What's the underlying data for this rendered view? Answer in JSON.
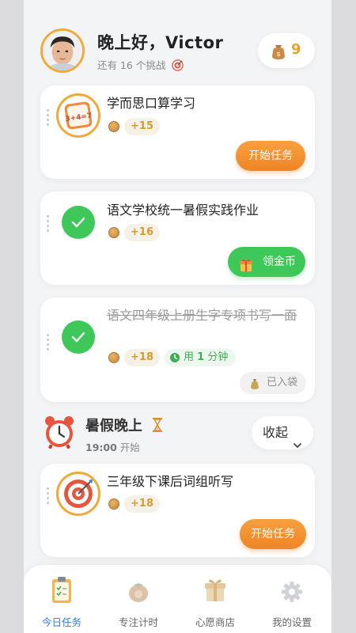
{
  "header": {
    "greeting": "晚上好，Victor",
    "subtitle": "还有 16 个挑战",
    "coins": "9"
  },
  "tasks": [
    {
      "title": "学而思口算学习",
      "points": "+15",
      "action_label": "开始任务",
      "status": "todo"
    },
    {
      "title": "语文学校统一暑假实践作业",
      "points": "+16",
      "action_label": "领金币",
      "status": "completed"
    },
    {
      "title": "语文四年级上册生字专项书写一面",
      "points": "+18",
      "duration_prefix": "用",
      "duration_value": "1",
      "duration_unit": "分钟",
      "action_label": "已入袋",
      "status": "collected"
    }
  ],
  "section": {
    "title": "暑假晚上",
    "time": "19:00",
    "time_suffix": "开始",
    "collapse_label": "收起"
  },
  "section_tasks": [
    {
      "title": "三年级下课后词组听写",
      "points": "+18",
      "action_label": "开始任务",
      "status": "todo"
    }
  ],
  "tabbar": {
    "items": [
      {
        "label": "今日任务",
        "icon": "clipboard-icon",
        "active": true
      },
      {
        "label": "专注计时",
        "icon": "tomato-timer-icon",
        "active": false
      },
      {
        "label": "心愿商店",
        "icon": "gift-box-icon",
        "active": false
      },
      {
        "label": "我的设置",
        "icon": "gear-icon",
        "active": false
      }
    ]
  },
  "colors": {
    "accent_orange": "#ef8424",
    "success_green": "#3fc85a",
    "coin_gold": "#e7a12a",
    "active_tab_blue": "#2f7de1"
  }
}
